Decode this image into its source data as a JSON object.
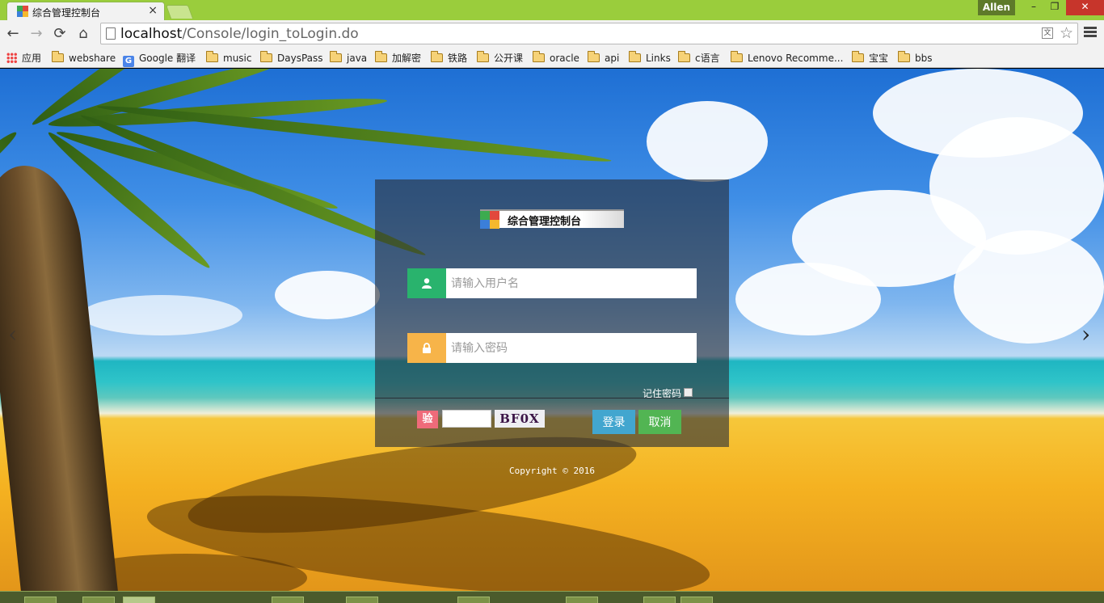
{
  "browser": {
    "tab": {
      "title": "综合管理控制台",
      "close_glyph": "×"
    },
    "profile_name": "Allen",
    "window_controls": {
      "minimize": "–",
      "maximize": "❐",
      "close": "✕"
    },
    "nav": {
      "back": "←",
      "forward": "→",
      "reload": "⟳",
      "home": "⌂"
    },
    "address": {
      "host": "localhost",
      "path": "/Console/login_toLogin.do"
    },
    "bookmarks": [
      {
        "label": "应用",
        "icon": "apps-icon"
      },
      {
        "label": "webshare",
        "icon": "folder-icon"
      },
      {
        "label": "Google 翻译",
        "icon": "google-translate-icon"
      },
      {
        "label": "music",
        "icon": "folder-icon"
      },
      {
        "label": "DaysPass",
        "icon": "folder-icon"
      },
      {
        "label": "java",
        "icon": "folder-icon"
      },
      {
        "label": "加解密",
        "icon": "folder-icon"
      },
      {
        "label": "铁路",
        "icon": "folder-icon"
      },
      {
        "label": "公开课",
        "icon": "folder-icon"
      },
      {
        "label": "oracle",
        "icon": "folder-icon"
      },
      {
        "label": "api",
        "icon": "folder-icon"
      },
      {
        "label": "Links",
        "icon": "folder-icon"
      },
      {
        "label": "c语言",
        "icon": "folder-icon"
      },
      {
        "label": "Lenovo Recomme...",
        "icon": "folder-icon"
      },
      {
        "label": "宝宝",
        "icon": "folder-icon"
      },
      {
        "label": "bbs",
        "icon": "folder-icon"
      }
    ]
  },
  "login": {
    "brand_title": "综合管理控制台",
    "username": {
      "placeholder": "请输入用户名",
      "value": ""
    },
    "password": {
      "placeholder": "请输入密码",
      "value": ""
    },
    "remember_label": "记住密码",
    "remember_checked": false,
    "captcha_badge": "验",
    "captcha_value": "",
    "captcha_code": "BF0X",
    "login_label": "登录",
    "cancel_label": "取消"
  },
  "footer": {
    "copyright": "Copyright © 2016"
  },
  "carousel": {
    "prev": "‹",
    "next": "›"
  },
  "colors": {
    "titlebar": "#9acd3c",
    "user_icon_bg": "#29b36d",
    "password_icon_bg": "#f7b449",
    "captcha_badge_bg": "#ef6b7a",
    "login_button": "#42a6cf",
    "cancel_button": "#52b553"
  }
}
